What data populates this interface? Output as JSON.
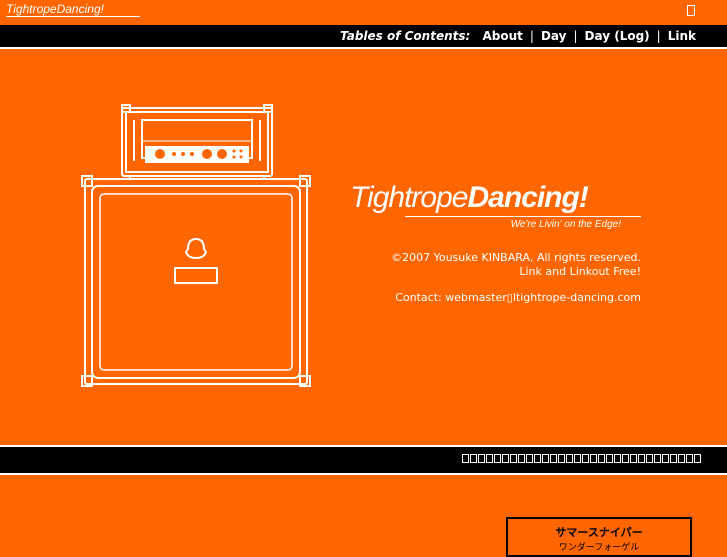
{
  "header": {
    "logo_text": "TightropeDancing!",
    "icon": "square-glyph-icon"
  },
  "nav": {
    "title": "Tables of Contents:",
    "items": [
      {
        "label": "About"
      },
      {
        "label": "Day"
      },
      {
        "label": "Day (Log)"
      },
      {
        "label": "Link"
      }
    ],
    "separator": "|"
  },
  "hero": {
    "image": "guitar-amp-stack-illustration",
    "brand_light": "Tightrope",
    "brand_bold": "Dancing!",
    "tagline": "We're Livin' on the Edge!",
    "copyright": "©2007 Yousuke KINBARA, All rights reserved.",
    "link_policy": "Link and Linkout Free!",
    "contact": "Contact: webmaster▯ltightrope-dancing.com"
  },
  "footer_bar": {
    "missing_glyph_count": 30
  },
  "widget": {
    "title": "サマースナイパー",
    "subtitle": "ワンダーフォーゲル"
  },
  "colors": {
    "background": "#ff6600",
    "bar": "#000000",
    "text": "#ffffff"
  }
}
